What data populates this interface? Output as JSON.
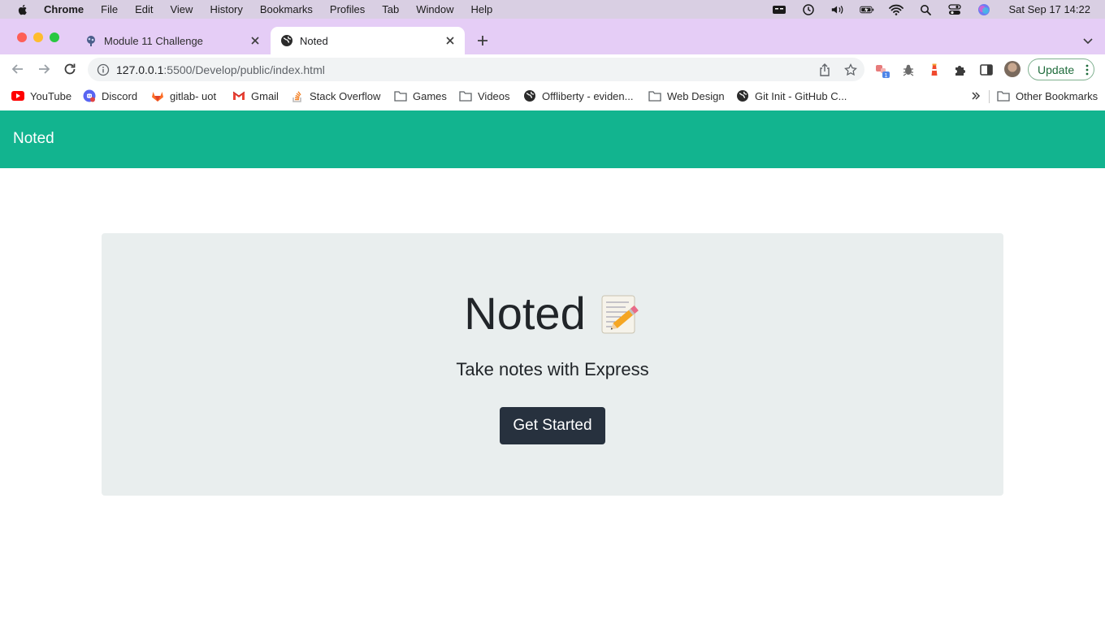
{
  "menubar": {
    "app_name": "Chrome",
    "items": [
      "File",
      "Edit",
      "View",
      "History",
      "Bookmarks",
      "Profiles",
      "Tab",
      "Window",
      "Help"
    ],
    "clock": "Sat Sep 17  14:22",
    "status_icons": [
      "screen-icon",
      "time-machine-icon",
      "volume-icon",
      "battery-icon",
      "wifi-icon",
      "spotlight-icon",
      "control-center-icon",
      "siri-icon"
    ]
  },
  "tabs": [
    {
      "title": "Module 11 Challenge",
      "icon": "repo-icon",
      "active": false
    },
    {
      "title": "Noted",
      "icon": "globe-icon",
      "active": true
    }
  ],
  "toolbar": {
    "url_host": "127.0.0.1",
    "url_rest": ":5500/Develop/public/index.html",
    "update_label": "Update",
    "extension_badge": "1"
  },
  "bookmarks": [
    {
      "label": "YouTube",
      "icon": "youtube-icon"
    },
    {
      "label": "Discord",
      "icon": "discord-icon"
    },
    {
      "label": "gitlab- uot",
      "icon": "gitlab-icon"
    },
    {
      "label": "Gmail",
      "icon": "gmail-icon"
    },
    {
      "label": "Stack Overflow",
      "icon": "stackoverflow-icon"
    },
    {
      "label": "Games",
      "icon": "folder-icon"
    },
    {
      "label": "Videos",
      "icon": "folder-icon"
    },
    {
      "label": "Offliberty - eviden...",
      "icon": "globe-icon"
    },
    {
      "label": "Web Design",
      "icon": "folder-icon"
    },
    {
      "label": "Git Init - GitHub C...",
      "icon": "globe-icon"
    },
    {
      "label": "Other Bookmarks",
      "icon": "folder-icon"
    }
  ],
  "page": {
    "brand": "Noted",
    "hero_title": "Noted",
    "hero_subtitle": "Take notes with Express",
    "cta_label": "Get Started",
    "colors": {
      "navbar": "#12b48f",
      "jumbotron": "#e9eeee",
      "button": "#27313e"
    }
  }
}
